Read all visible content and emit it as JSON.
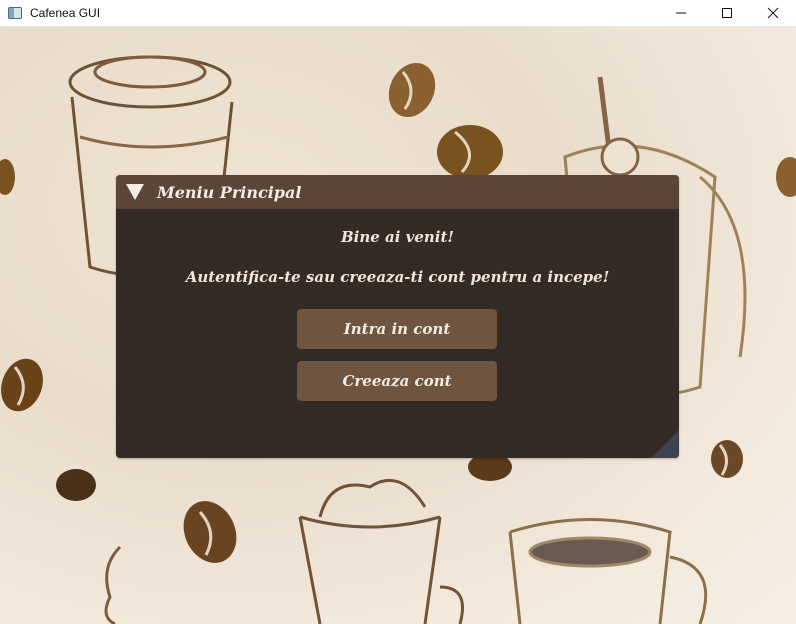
{
  "window": {
    "title": "Cafenea GUI",
    "controls": [
      "minimize-icon",
      "maximize-icon",
      "close-icon"
    ]
  },
  "panel": {
    "title": "Meniu Principal",
    "welcome": "Bine ai venit!",
    "instruction": "Autentifica-te sau creeaza-ti cont pentru a incepe!",
    "buttons": {
      "login": "Intra in cont",
      "create": "Creeaza cont"
    }
  },
  "colors": {
    "panel_bg": "#352b26",
    "header_bg": "#5a4536",
    "button_bg": "#6f5440",
    "text": "#f1e6da"
  }
}
